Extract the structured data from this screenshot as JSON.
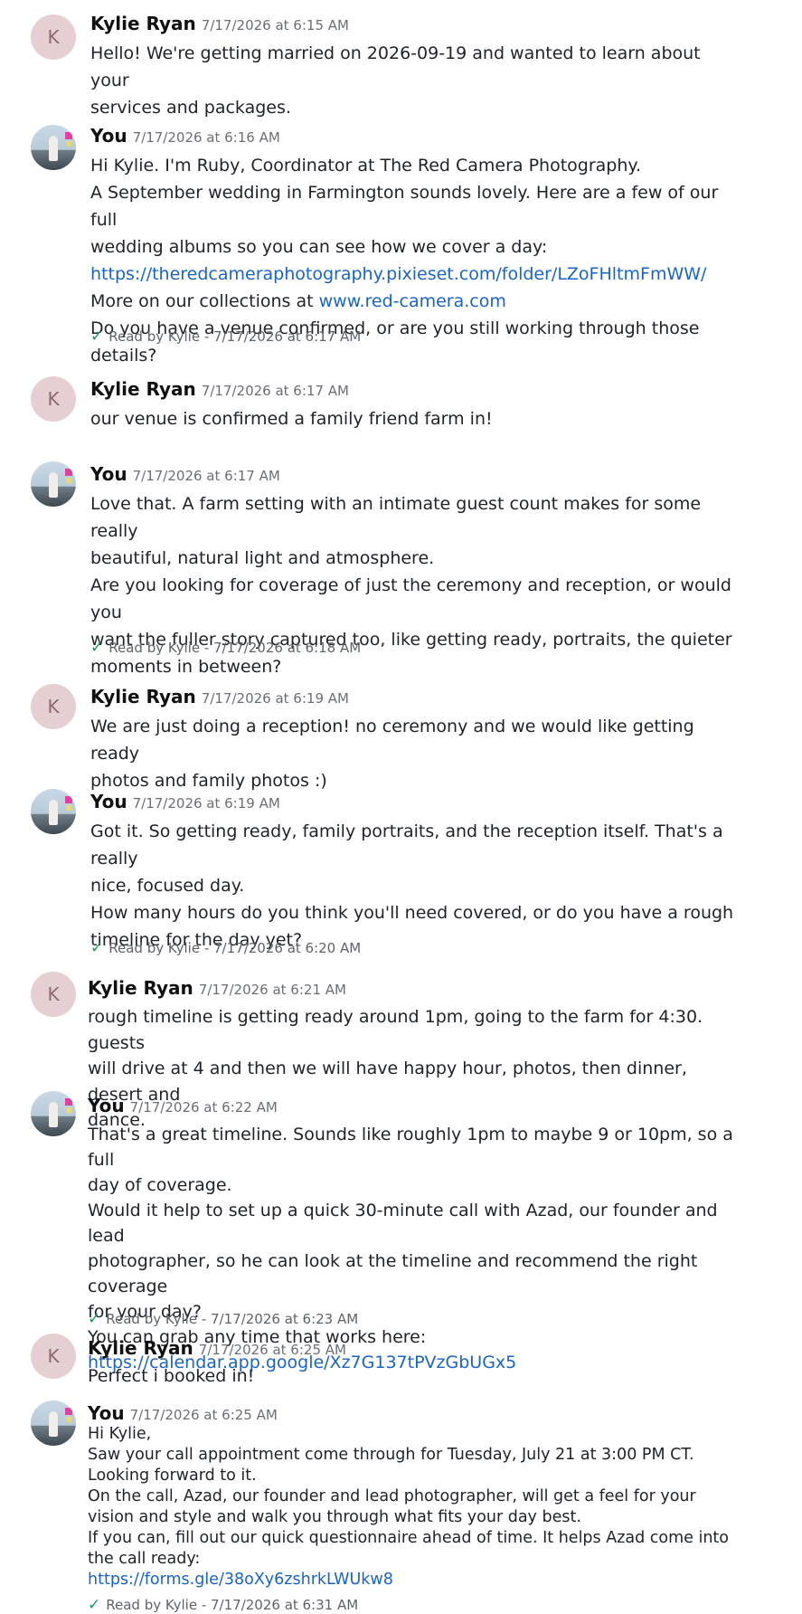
{
  "messages": [
    {
      "author": "Kylie Ryan",
      "time": "7/17/2026 at 6:15 AM",
      "avatar_letter": "K",
      "lines": [
        {
          "t": "Hello! We're getting married on 2026-09-19 and wanted to learn about your"
        },
        {
          "t": "services and packages."
        }
      ]
    },
    {
      "author": "You",
      "time": "7/17/2026 at 6:16 AM",
      "lines": [
        {
          "t": "Hi Kylie. I'm Ruby, Coordinator at The Red Camera Photography."
        },
        {
          "t": "A September wedding in Farmington sounds lovely. Here are a few of our full"
        },
        {
          "t": "wedding albums so you can see how we cover a day:"
        },
        {
          "link": "https://theredcameraphotography.pixieset.com/folder/LZoFHltmFmWW/"
        },
        {
          "t": "More on our collections at ",
          "link": "www.red-camera.com"
        },
        {
          "t": "Do you have a venue confirmed, or are you still working through those details?"
        }
      ],
      "read": "Read by Kylie - 7/17/2026 at 6:17 AM"
    },
    {
      "author": "Kylie Ryan",
      "time": "7/17/2026 at 6:17 AM",
      "avatar_letter": "K",
      "lines": [
        {
          "t": "our venue is confirmed a family friend farm in!"
        }
      ]
    },
    {
      "author": "You",
      "time": "7/17/2026 at 6:17 AM",
      "lines": [
        {
          "t": "Love that. A farm setting with an intimate guest count makes for some really"
        },
        {
          "t": "beautiful, natural light and atmosphere."
        },
        {
          "t": "Are you looking for coverage of just the ceremony and reception, or would you"
        },
        {
          "t": "want the fuller story captured too, like getting ready, portraits, the quieter"
        },
        {
          "t": "moments in between?"
        }
      ],
      "read": "Read by Kylie - 7/17/2026 at 6:18 AM"
    },
    {
      "author": "Kylie Ryan",
      "time": "7/17/2026 at 6:19 AM",
      "avatar_letter": "K",
      "lines": [
        {
          "t": "We are just doing a reception! no ceremony and we would like getting ready"
        },
        {
          "t": "photos and family photos :)"
        }
      ]
    },
    {
      "author": "You",
      "time": "7/17/2026 at 6:19 AM",
      "lines": [
        {
          "t": "Got it. So getting ready, family portraits, and the reception itself. That's a really"
        },
        {
          "t": "nice, focused day."
        },
        {
          "t": "How many hours do you think you'll need covered, or do you have a rough"
        },
        {
          "t": "timeline for the day yet?"
        }
      ],
      "read": "Read by Kylie - 7/17/2026 at 6:20 AM"
    },
    {
      "author": "Kylie Ryan",
      "time": "7/17/2026 at 6:21 AM",
      "avatar_letter": "K",
      "lines": [
        {
          "t": "rough timeline is getting ready around 1pm, going to the farm for 4:30. guests"
        },
        {
          "t": "will drive at 4 and then we will have happy hour, photos, then dinner, desert and"
        },
        {
          "t": "dance."
        }
      ]
    },
    {
      "author": "You",
      "time": "7/17/2026 at 6:22 AM",
      "lines": [
        {
          "t": "That's a great timeline. Sounds like roughly 1pm to maybe 9 or 10pm, so a full"
        },
        {
          "t": "day of coverage."
        },
        {
          "t": "Would it help to set up a quick 30-minute call with Azad, our founder and lead"
        },
        {
          "t": "photographer, so he can look at the timeline and recommend the right coverage"
        },
        {
          "t": "for your day?"
        },
        {
          "t": "You can grab any time that works here:"
        },
        {
          "link": "https://calendar.app.google/Xz7G137tPVzGbUGx5"
        }
      ],
      "read": "Read by Kylie - 7/17/2026 at 6:23 AM"
    },
    {
      "author": "Kylie Ryan",
      "time": "7/17/2026 at 6:25 AM",
      "avatar_letter": "K",
      "lines": [
        {
          "t": "Perfect i booked in!"
        }
      ]
    },
    {
      "author": "You",
      "time": "7/17/2026 at 6:25 AM",
      "lines": [
        {
          "t": "Hi Kylie,"
        },
        {
          "t": "Saw your call appointment come through for Tuesday, July 21 at 3:00 PM CT."
        },
        {
          "t": "Looking forward to it."
        },
        {
          "t": "On the call, Azad, our founder and lead photographer, will get a feel for your"
        },
        {
          "t": "vision and style and walk you through what fits your day best."
        },
        {
          "t": "If you can, fill out our quick questionnaire ahead of time. It helps Azad come into"
        },
        {
          "t": "the call ready:"
        },
        {
          "link": "https://forms.gle/38oXy6zshrkLWUkw8"
        }
      ],
      "read": "Read by Kylie - 7/17/2026 at 6:31 AM"
    }
  ]
}
